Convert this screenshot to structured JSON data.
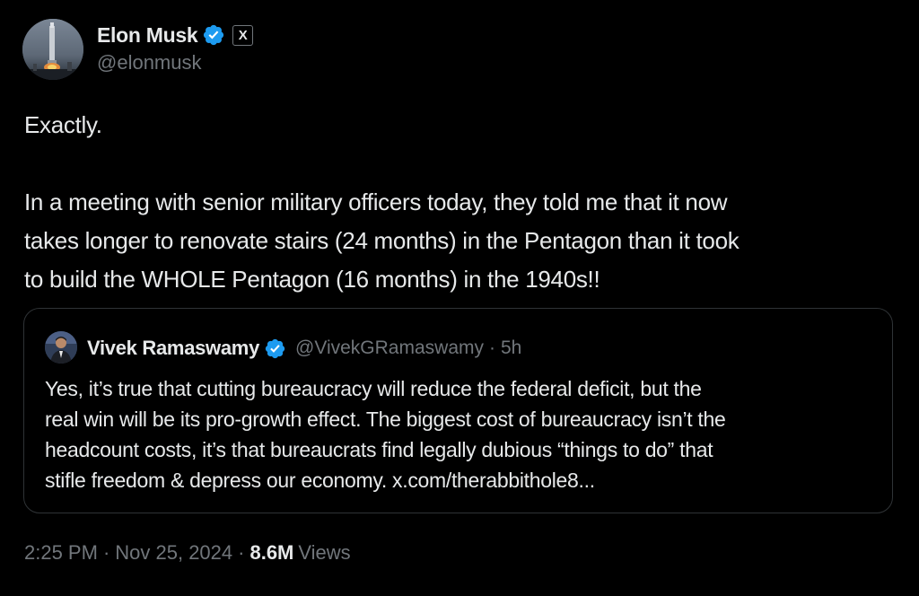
{
  "author": {
    "display_name": "Elon Musk",
    "handle": "@elonmusk",
    "verified": true,
    "affiliation_badge": "X"
  },
  "tweet": {
    "lines": [
      "Exactly.",
      "",
      "In a meeting with senior military officers today, they told me that it now",
      "takes longer to renovate stairs (24 months) in the Pentagon than it took",
      "to build the WHOLE Pentagon (16 months) in the 1940s!!"
    ]
  },
  "quote": {
    "display_name": "Vivek Ramaswamy",
    "handle": "@VivekGRamaswamy",
    "separator": "·",
    "time": "5h",
    "verified": true,
    "lines": [
      "Yes, it’s true that cutting bureaucracy will reduce the federal deficit, but the",
      "real win will be its pro-growth effect. The biggest cost of bureaucracy isn’t the",
      "headcount costs, it’s that bureaucrats find legally dubious “things to do” that",
      "stifle freedom & depress our economy. x.com/therabbithole8..."
    ]
  },
  "meta": {
    "time": "2:25 PM",
    "sep1": "·",
    "date": "Nov 25, 2024",
    "sep2": "·",
    "views_count": "8.6M",
    "views_label": "Views"
  },
  "colors": {
    "background": "#000000",
    "text": "#e7e9ea",
    "secondary": "#71767b",
    "verified_blue": "#1d9bf0",
    "border": "#2f3336"
  }
}
